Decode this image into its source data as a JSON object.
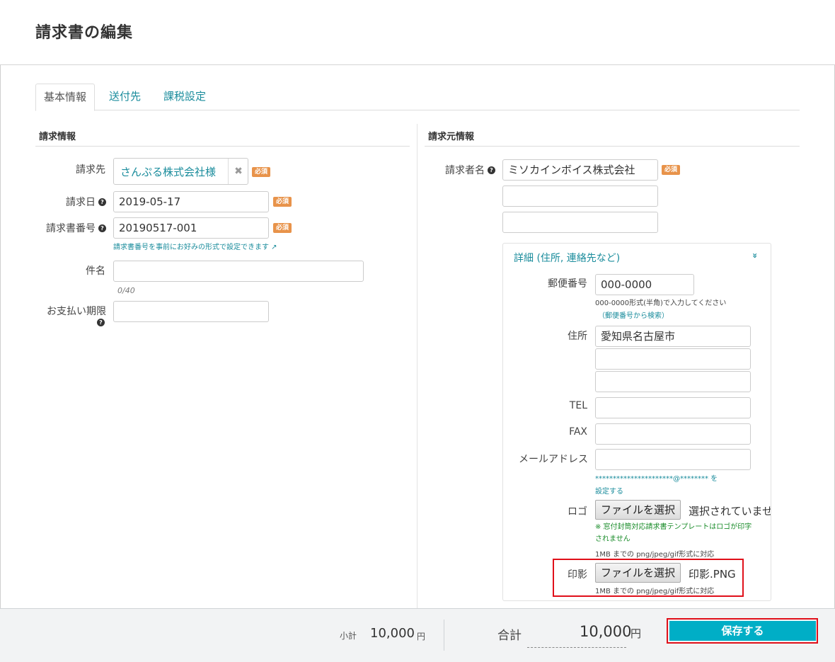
{
  "page": {
    "title": "請求書の編集"
  },
  "tabs": [
    {
      "label": "基本情報",
      "active": true
    },
    {
      "label": "送付先",
      "active": false
    },
    {
      "label": "課税設定",
      "active": false
    }
  ],
  "required_badge": "必須",
  "help_icon": "?",
  "invoice_info": {
    "section_title": "請求情報",
    "client": {
      "label": "請求先",
      "value": "さんぷる株式会社様",
      "clear_icon": "✖"
    },
    "date": {
      "label": "請求日",
      "value": "2019-05-17"
    },
    "number": {
      "label": "請求書番号",
      "value": "20190517-001",
      "hint": "請求書番号を事前にお好みの形式で設定できます ↗"
    },
    "subject": {
      "label": "件名",
      "value": "",
      "counter": "0/40"
    },
    "due_date": {
      "label": "お支払い期限",
      "value": ""
    }
  },
  "issuer_info": {
    "section_title": "請求元情報",
    "name": {
      "label": "請求者名",
      "value": "ミソカインボイス株式会社",
      "line2": "",
      "line3": ""
    },
    "details": {
      "toggle_label": "詳細 (住所, 連絡先など)",
      "toggle_icon": "»",
      "postal": {
        "label": "郵便番号",
        "value": "000-0000",
        "note": "000-0000形式(半角)で入力してください",
        "search_link": "（郵便番号から検索）"
      },
      "address": {
        "label": "住所",
        "line1": "愛知県名古屋市",
        "line2": "",
        "line3": ""
      },
      "tel": {
        "label": "TEL",
        "value": ""
      },
      "fax": {
        "label": "FAX",
        "value": ""
      },
      "email": {
        "label": "メールアドレス",
        "value": "",
        "hint_line1": "**********************@******** を",
        "hint_line2": "設定する"
      },
      "logo": {
        "label": "ロゴ",
        "button": "ファイルを選択",
        "file_status": "選択されていませ",
        "warning": "※ 窓付封筒対応請求書テンプレートはロゴが印字されません",
        "format_note": "1MB までの png/jpeg/gif形式に対応"
      },
      "seal": {
        "label": "印影",
        "button": "ファイルを選択",
        "file_status": "印影.PNG",
        "format_note": "1MB までの png/jpeg/gif形式に対応"
      }
    }
  },
  "footer": {
    "subtotal_label": "小計",
    "subtotal_value": "10,000",
    "subtotal_unit": "円",
    "total_label": "合計",
    "total_value": "10,000",
    "total_unit": "円",
    "save_label": "保存する"
  },
  "colors": {
    "accent": "#1a8c9c",
    "required": "#e8934a",
    "save_button": "#00aec6",
    "highlight": "#e0101a"
  }
}
